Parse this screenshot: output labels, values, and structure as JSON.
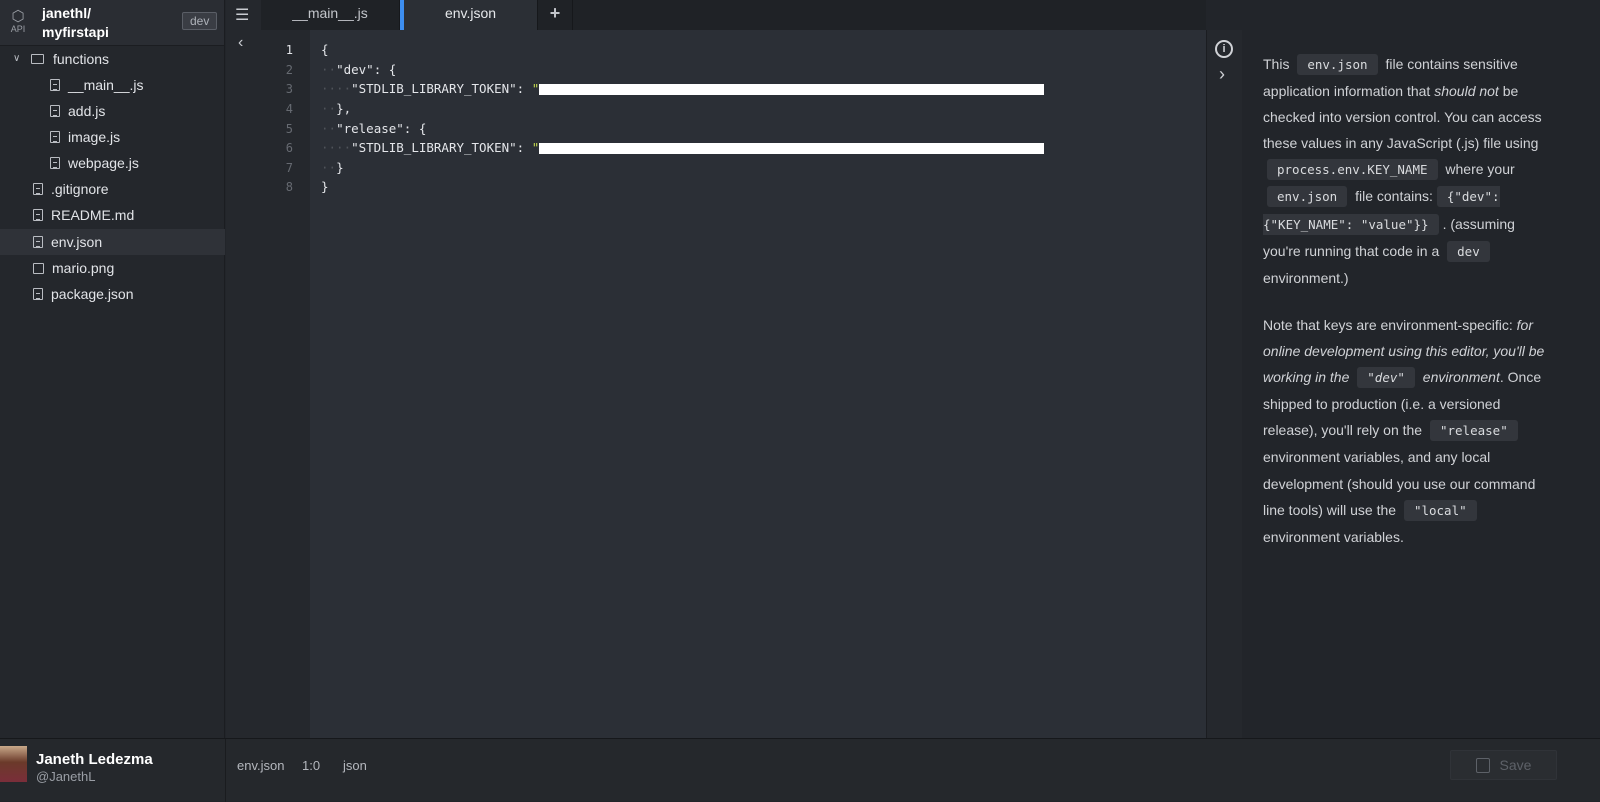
{
  "project": {
    "icon_label": "API",
    "owner": "janethl/",
    "name": "myfirstapi",
    "env_badge": "dev"
  },
  "tree": {
    "folder": "functions",
    "function_files": [
      "__main__.js",
      "add.js",
      "image.js",
      "webpage.js"
    ],
    "root_files": [
      ".gitignore",
      "README.md",
      "env.json",
      "mario.png",
      "package.json"
    ],
    "selected": "env.json"
  },
  "tabs": [
    {
      "label": "__main__.js"
    },
    {
      "label": "env.json",
      "active": true
    },
    {
      "label": "+"
    }
  ],
  "editor": {
    "line_numbers": [
      "1",
      "2",
      "3",
      "4",
      "5",
      "6",
      "7",
      "8"
    ],
    "lines": [
      "{",
      "\"dev\": {",
      "\"STDLIB_LIBRARY_TOKEN\": ",
      "},",
      "\"release\": {",
      "\"STDLIB_LIBRARY_TOKEN\": ",
      "}",
      "}"
    ],
    "string_open": "\""
  },
  "info": {
    "p1": [
      "This ",
      "env.json",
      " file contains sensitive application information that ",
      "should not",
      " be checked into version control. You can access these values in any JavaScript (.js) file using ",
      "process.env.KEY_NAME",
      " where your ",
      "env.json",
      " file contains: ",
      "{\"dev\": {\"KEY_NAME\": \"value\"}}",
      ". (assuming you're running that code in a ",
      "dev",
      " environment.)"
    ],
    "p2": [
      "Note that keys are environment-specific: ",
      "for online development using this editor, you'll be working in the ",
      "\"dev\"",
      " environment",
      ". Once shipped to production (i.e. a versioned release), you'll rely on the ",
      "\"release\"",
      " environment variables, and any local development (should you use our command line tools) will use the ",
      "\"local\"",
      " environment variables."
    ]
  },
  "user": {
    "name": "Janeth Ledezma",
    "handle": "@JanethL"
  },
  "status": {
    "file": "env.json",
    "cursor": "1:0",
    "mode": "json"
  },
  "save_label": "Save"
}
